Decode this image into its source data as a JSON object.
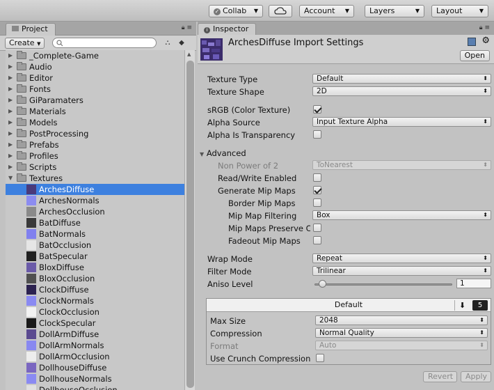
{
  "toolbar": {
    "collab_label": "Collab",
    "account_label": "Account",
    "layers_label": "Layers",
    "layout_label": "Layout"
  },
  "project": {
    "tab_label": "Project",
    "create_label": "Create",
    "folders": [
      "_Complete-Game",
      "Audio",
      "Editor",
      "Fonts",
      "GiParamaters",
      "Materials",
      "Models",
      "PostProcessing",
      "Prefabs",
      "Profiles",
      "Scripts",
      "Textures"
    ],
    "textures": [
      {
        "name": "ArchesDiffuse",
        "color": "#4a3a7a",
        "selected": true
      },
      {
        "name": "ArchesNormals",
        "color": "#8c8cf0"
      },
      {
        "name": "ArchesOcclusion",
        "color": "#8a8a8a"
      },
      {
        "name": "BatDiffuse",
        "color": "#3a3a3a"
      },
      {
        "name": "BatNormals",
        "color": "#8080ee"
      },
      {
        "name": "BatOcclusion",
        "color": "#e6e6e6"
      },
      {
        "name": "BatSpecular",
        "color": "#202020"
      },
      {
        "name": "BloxDiffuse",
        "color": "#6a5aa8"
      },
      {
        "name": "BloxOcclusion",
        "color": "#505050"
      },
      {
        "name": "ClockDiffuse",
        "color": "#2c2250"
      },
      {
        "name": "ClockNormals",
        "color": "#8a8af2"
      },
      {
        "name": "ClockOcclusion",
        "color": "#f2f2f2"
      },
      {
        "name": "ClockSpecular",
        "color": "#1a1a1a"
      },
      {
        "name": "DollArmDiffuse",
        "color": "#5a4a90"
      },
      {
        "name": "DollArmNormals",
        "color": "#8888f0"
      },
      {
        "name": "DollArmOcclusion",
        "color": "#ededed"
      },
      {
        "name": "DollhouseDiffuse",
        "color": "#7a66c0"
      },
      {
        "name": "DollhouseNormals",
        "color": "#8a8af2"
      },
      {
        "name": "DollhouseOcclusion",
        "color": "#e0e0e0"
      }
    ]
  },
  "inspector": {
    "tab_label": "Inspector",
    "title": "ArchesDiffuse Import Settings",
    "open_label": "Open",
    "texture_type_label": "Texture Type",
    "texture_type_value": "Default",
    "texture_shape_label": "Texture Shape",
    "texture_shape_value": "2D",
    "srgb_label": "sRGB (Color Texture)",
    "srgb_checked": true,
    "alpha_source_label": "Alpha Source",
    "alpha_source_value": "Input Texture Alpha",
    "alpha_transparency_label": "Alpha Is Transparency",
    "alpha_transparency_checked": false,
    "advanced_label": "Advanced",
    "npot_label": "Non Power of 2",
    "npot_value": "ToNearest",
    "readwrite_label": "Read/Write Enabled",
    "readwrite_checked": false,
    "mipmaps_label": "Generate Mip Maps",
    "mipmaps_checked": true,
    "border_mip_label": "Border Mip Maps",
    "border_mip_checked": false,
    "mip_filter_label": "Mip Map Filtering",
    "mip_filter_value": "Box",
    "mip_preserve_label": "Mip Maps Preserve C",
    "mip_preserve_checked": false,
    "fadeout_label": "Fadeout Mip Maps",
    "fadeout_checked": false,
    "wrap_label": "Wrap Mode",
    "wrap_value": "Repeat",
    "filter_label": "Filter Mode",
    "filter_value": "Trilinear",
    "aniso_label": "Aniso Level",
    "aniso_value": "1",
    "aniso_fraction": 0.0,
    "platform_label": "Default",
    "max_size_label": "Max Size",
    "max_size_value": "2048",
    "compression_label": "Compression",
    "compression_value": "Normal Quality",
    "format_label": "Format",
    "format_value": "Auto",
    "crunch_label": "Use Crunch Compression",
    "crunch_checked": false,
    "revert_label": "Revert",
    "apply_label": "Apply"
  }
}
